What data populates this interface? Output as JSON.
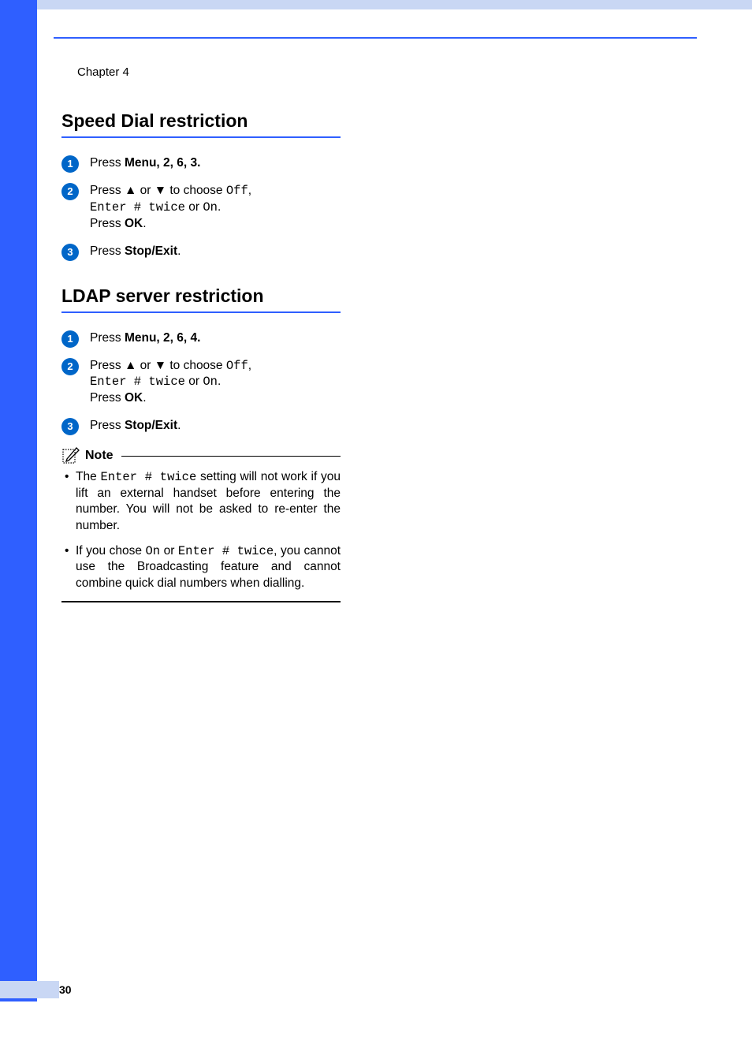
{
  "chapter_label": "Chapter 4",
  "page_number": "30",
  "section1": {
    "title": "Speed Dial restriction",
    "steps": [
      {
        "num": "1",
        "press": "Press ",
        "menu": "Menu",
        "seq": ", 2, 6, 3."
      },
      {
        "num": "2",
        "line1_a": "Press ",
        "up": "a",
        "mid": " or ",
        "down": "b",
        "line1_b": " to choose ",
        "off": "Off",
        "comma": ",",
        "line2_a": "Enter # twice",
        "line2_or": " or ",
        "line2_on": "On",
        "line2_end": ".",
        "line3_a": "Press ",
        "ok": "OK",
        "line3_end": "."
      },
      {
        "num": "3",
        "press": "Press ",
        "btn": "Stop/Exit",
        "end": "."
      }
    ]
  },
  "section2": {
    "title": "LDAP server restriction",
    "steps": [
      {
        "num": "1",
        "press": "Press ",
        "menu": "Menu",
        "seq": ", 2, 6, 4."
      },
      {
        "num": "2",
        "line1_a": "Press ",
        "up": "a",
        "mid": " or ",
        "down": "b",
        "line1_b": " to choose ",
        "off": "Off",
        "comma": ",",
        "line2_a": "Enter # twice",
        "line2_or": " or ",
        "line2_on": "On",
        "line2_end": ".",
        "line3_a": "Press ",
        "ok": "OK",
        "line3_end": "."
      },
      {
        "num": "3",
        "press": "Press ",
        "btn": "Stop/Exit",
        "end": "."
      }
    ]
  },
  "note": {
    "title": "Note",
    "bullet1": {
      "a": "The ",
      "code": "Enter # twice",
      "b": " setting will not work if you lift an external handset before entering the number. You will not be asked to re-enter the number."
    },
    "bullet2": {
      "a": "If you chose ",
      "on": "On",
      "or": " or ",
      "code": "Enter # twice",
      "b": ", you cannot use the Broadcasting feature and cannot combine quick dial numbers when dialling."
    }
  }
}
